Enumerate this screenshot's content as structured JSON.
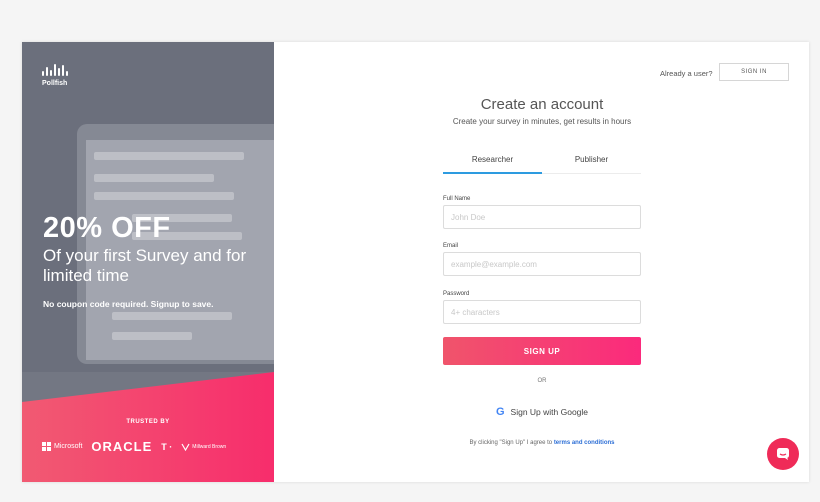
{
  "brand": {
    "name": "Pollfish"
  },
  "promo": {
    "headline": "20% OFF",
    "subline": "Of your first Survey and for limited time",
    "note": "No coupon code required. Signup to save.",
    "trusted_label": "TRUSTED BY",
    "logos": [
      "Microsoft",
      "ORACLE",
      "T ·",
      "Millward Brown"
    ]
  },
  "header": {
    "already_text": "Already a user?",
    "signin_label": "SIGN IN"
  },
  "form": {
    "title": "Create an account",
    "subtitle": "Create your survey in minutes, get results in hours",
    "tabs": [
      {
        "label": "Researcher",
        "active": true
      },
      {
        "label": "Publisher",
        "active": false
      }
    ],
    "full_name": {
      "label": "Full Name",
      "placeholder": "John Doe",
      "value": ""
    },
    "email": {
      "label": "Email",
      "placeholder": "example@example.com",
      "value": ""
    },
    "password": {
      "label": "Password",
      "placeholder": "4+ characters",
      "value": ""
    },
    "signup_label": "SIGN UP",
    "or_label": "OR",
    "google_label": "Sign Up with Google",
    "terms_prefix": "By clicking \"Sign Up\" I agree to",
    "terms_link": "terms and conditions"
  },
  "colors": {
    "accent_pink": "#fb2a7c",
    "tab_blue": "#2d9be0",
    "chat_bubble": "#ef2b58"
  },
  "icons": {
    "google": "google-icon",
    "chat": "chat-icon"
  }
}
